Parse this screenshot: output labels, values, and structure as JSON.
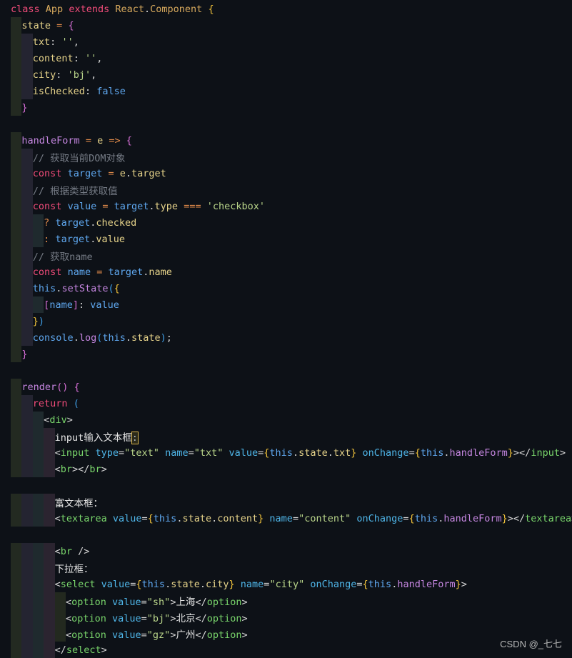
{
  "lines": [
    {
      "indent": 0,
      "tokens": [
        [
          "class",
          "k"
        ],
        [
          " ",
          "pn"
        ],
        [
          "App",
          "cls"
        ],
        [
          " ",
          "pn"
        ],
        [
          "extends",
          "k"
        ],
        [
          " ",
          "pn"
        ],
        [
          "React",
          "cls"
        ],
        [
          ".",
          "pn"
        ],
        [
          "Component",
          "cls"
        ],
        [
          " ",
          "pn"
        ],
        [
          "{",
          "g1"
        ]
      ]
    },
    {
      "indent": 1,
      "tokens": [
        [
          "state",
          "p"
        ],
        [
          " ",
          "pn"
        ],
        [
          "=",
          "op"
        ],
        [
          " ",
          "pn"
        ],
        [
          "{",
          "g2"
        ]
      ]
    },
    {
      "indent": 2,
      "tokens": [
        [
          "txt",
          "p"
        ],
        [
          ":",
          "pn"
        ],
        [
          " ",
          "pn"
        ],
        [
          "''",
          "s"
        ],
        [
          ",",
          "pn"
        ]
      ]
    },
    {
      "indent": 2,
      "tokens": [
        [
          "content",
          "p"
        ],
        [
          ":",
          "pn"
        ],
        [
          " ",
          "pn"
        ],
        [
          "''",
          "s"
        ],
        [
          ",",
          "pn"
        ]
      ]
    },
    {
      "indent": 2,
      "tokens": [
        [
          "city",
          "p"
        ],
        [
          ":",
          "pn"
        ],
        [
          " ",
          "pn"
        ],
        [
          "'bj'",
          "s"
        ],
        [
          ",",
          "pn"
        ]
      ]
    },
    {
      "indent": 2,
      "tokens": [
        [
          "isChecked",
          "p"
        ],
        [
          ":",
          "pn"
        ],
        [
          " ",
          "pn"
        ],
        [
          "false",
          "b"
        ]
      ]
    },
    {
      "indent": 1,
      "tokens": [
        [
          "}",
          "g2"
        ]
      ]
    },
    {
      "indent": 0,
      "tokens": []
    },
    {
      "indent": 1,
      "tokens": [
        [
          "handleForm",
          "f"
        ],
        [
          " ",
          "pn"
        ],
        [
          "=",
          "op"
        ],
        [
          " ",
          "pn"
        ],
        [
          "e",
          "p"
        ],
        [
          " ",
          "pn"
        ],
        [
          "=>",
          "op"
        ],
        [
          " ",
          "pn"
        ],
        [
          "{",
          "g2"
        ]
      ]
    },
    {
      "indent": 2,
      "tokens": [
        [
          "// 获取当前DOM对象",
          "c"
        ]
      ]
    },
    {
      "indent": 2,
      "tokens": [
        [
          "const",
          "k"
        ],
        [
          " ",
          "pn"
        ],
        [
          "target",
          "b"
        ],
        [
          " ",
          "pn"
        ],
        [
          "=",
          "op"
        ],
        [
          " ",
          "pn"
        ],
        [
          "e",
          "p"
        ],
        [
          ".",
          "pn"
        ],
        [
          "target",
          "p"
        ]
      ]
    },
    {
      "indent": 2,
      "tokens": [
        [
          "// 根据类型获取值",
          "c"
        ]
      ]
    },
    {
      "indent": 2,
      "tokens": [
        [
          "const",
          "k"
        ],
        [
          " ",
          "pn"
        ],
        [
          "value",
          "b"
        ],
        [
          " ",
          "pn"
        ],
        [
          "=",
          "op"
        ],
        [
          " ",
          "pn"
        ],
        [
          "target",
          "b"
        ],
        [
          ".",
          "pn"
        ],
        [
          "type",
          "p"
        ],
        [
          " ",
          "pn"
        ],
        [
          "===",
          "op"
        ],
        [
          " ",
          "pn"
        ],
        [
          "'checkbox'",
          "s"
        ]
      ]
    },
    {
      "indent": 3,
      "tokens": [
        [
          "?",
          "op"
        ],
        [
          " ",
          "pn"
        ],
        [
          "target",
          "b"
        ],
        [
          ".",
          "pn"
        ],
        [
          "checked",
          "p"
        ]
      ]
    },
    {
      "indent": 3,
      "tokens": [
        [
          ":",
          "op"
        ],
        [
          " ",
          "pn"
        ],
        [
          "target",
          "b"
        ],
        [
          ".",
          "pn"
        ],
        [
          "value",
          "p"
        ]
      ]
    },
    {
      "indent": 2,
      "tokens": [
        [
          "// 获取name",
          "c"
        ]
      ]
    },
    {
      "indent": 2,
      "tokens": [
        [
          "const",
          "k"
        ],
        [
          " ",
          "pn"
        ],
        [
          "name",
          "b"
        ],
        [
          " ",
          "pn"
        ],
        [
          "=",
          "op"
        ],
        [
          " ",
          "pn"
        ],
        [
          "target",
          "b"
        ],
        [
          ".",
          "pn"
        ],
        [
          "name",
          "p"
        ]
      ]
    },
    {
      "indent": 2,
      "tokens": [
        [
          "this",
          "b"
        ],
        [
          ".",
          "pn"
        ],
        [
          "setState",
          "f"
        ],
        [
          "(",
          "g3"
        ],
        [
          "{",
          "g1"
        ]
      ]
    },
    {
      "indent": 3,
      "tokens": [
        [
          "[",
          "g2"
        ],
        [
          "name",
          "b"
        ],
        [
          "]",
          "g2"
        ],
        [
          ":",
          "pn"
        ],
        [
          " ",
          "pn"
        ],
        [
          "value",
          "b"
        ]
      ]
    },
    {
      "indent": 2,
      "tokens": [
        [
          "}",
          "g1"
        ],
        [
          ")",
          "g3"
        ]
      ]
    },
    {
      "indent": 2,
      "tokens": [
        [
          "console",
          "b"
        ],
        [
          ".",
          "pn"
        ],
        [
          "log",
          "f"
        ],
        [
          "(",
          "g3"
        ],
        [
          "this",
          "b"
        ],
        [
          ".",
          "pn"
        ],
        [
          "state",
          "p"
        ],
        [
          ")",
          "g3"
        ],
        [
          ";",
          "pn"
        ]
      ]
    },
    {
      "indent": 1,
      "tokens": [
        [
          "}",
          "g2"
        ]
      ]
    },
    {
      "indent": 0,
      "tokens": []
    },
    {
      "indent": 1,
      "tokens": [
        [
          "render",
          "f"
        ],
        [
          "()",
          "g2"
        ],
        [
          " ",
          "pn"
        ],
        [
          "{",
          "g2"
        ]
      ]
    },
    {
      "indent": 2,
      "tokens": [
        [
          "return",
          "k"
        ],
        [
          " ",
          "pn"
        ],
        [
          "(",
          "g3"
        ]
      ]
    },
    {
      "indent": 3,
      "tokens": [
        [
          "<",
          "pn"
        ],
        [
          "div",
          "tg"
        ],
        [
          ">",
          "pn"
        ]
      ]
    },
    {
      "indent": 4,
      "tokens": [
        [
          "input输入文本框",
          "tx"
        ],
        [
          ":",
          "hl"
        ]
      ]
    },
    {
      "indent": 4,
      "tokens": [
        [
          "<",
          "pn"
        ],
        [
          "input",
          "tg"
        ],
        [
          " ",
          "pn"
        ],
        [
          "type",
          "at"
        ],
        [
          "=",
          "pn"
        ],
        [
          "\"text\"",
          "s"
        ],
        [
          " ",
          "pn"
        ],
        [
          "name",
          "at"
        ],
        [
          "=",
          "pn"
        ],
        [
          "\"txt\"",
          "s"
        ],
        [
          " ",
          "pn"
        ],
        [
          "value",
          "at"
        ],
        [
          "=",
          "pn"
        ],
        [
          "{",
          "g1"
        ],
        [
          "this",
          "b"
        ],
        [
          ".",
          "pn"
        ],
        [
          "state",
          "p"
        ],
        [
          ".",
          "pn"
        ],
        [
          "txt",
          "p"
        ],
        [
          "}",
          "g1"
        ],
        [
          " ",
          "pn"
        ],
        [
          "onChange",
          "at"
        ],
        [
          "=",
          "pn"
        ],
        [
          "{",
          "g1"
        ],
        [
          "this",
          "b"
        ],
        [
          ".",
          "pn"
        ],
        [
          "handleForm",
          "f"
        ],
        [
          "}",
          "g1"
        ],
        [
          "></",
          "pn"
        ],
        [
          "input",
          "tg"
        ],
        [
          ">",
          "pn"
        ]
      ]
    },
    {
      "indent": 4,
      "tokens": [
        [
          "<",
          "pn"
        ],
        [
          "br",
          "tg"
        ],
        [
          "></",
          "pn"
        ],
        [
          "br",
          "tg"
        ],
        [
          ">",
          "pn"
        ]
      ]
    },
    {
      "indent": 0,
      "tokens": []
    },
    {
      "indent": 4,
      "tokens": [
        [
          "富文本框：",
          "tx"
        ]
      ]
    },
    {
      "indent": 4,
      "tokens": [
        [
          "<",
          "pn"
        ],
        [
          "textarea",
          "tg"
        ],
        [
          " ",
          "pn"
        ],
        [
          "value",
          "at"
        ],
        [
          "=",
          "pn"
        ],
        [
          "{",
          "g1"
        ],
        [
          "this",
          "b"
        ],
        [
          ".",
          "pn"
        ],
        [
          "state",
          "p"
        ],
        [
          ".",
          "pn"
        ],
        [
          "content",
          "p"
        ],
        [
          "}",
          "g1"
        ],
        [
          " ",
          "pn"
        ],
        [
          "name",
          "at"
        ],
        [
          "=",
          "pn"
        ],
        [
          "\"content\"",
          "s"
        ],
        [
          " ",
          "pn"
        ],
        [
          "onChange",
          "at"
        ],
        [
          "=",
          "pn"
        ],
        [
          "{",
          "g1"
        ],
        [
          "this",
          "b"
        ],
        [
          ".",
          "pn"
        ],
        [
          "handleForm",
          "f"
        ],
        [
          "}",
          "g1"
        ],
        [
          "></",
          "pn"
        ],
        [
          "textarea",
          "tg"
        ],
        [
          ">",
          "pn"
        ]
      ]
    },
    {
      "indent": 0,
      "tokens": []
    },
    {
      "indent": 4,
      "tokens": [
        [
          "<",
          "pn"
        ],
        [
          "br",
          "tg"
        ],
        [
          " ",
          "pn"
        ],
        [
          "/>",
          "pn"
        ]
      ]
    },
    {
      "indent": 4,
      "tokens": [
        [
          "下拉框：",
          "tx"
        ]
      ]
    },
    {
      "indent": 4,
      "tokens": [
        [
          "<",
          "pn"
        ],
        [
          "select",
          "tg"
        ],
        [
          " ",
          "pn"
        ],
        [
          "value",
          "at"
        ],
        [
          "=",
          "pn"
        ],
        [
          "{",
          "g1"
        ],
        [
          "this",
          "b"
        ],
        [
          ".",
          "pn"
        ],
        [
          "state",
          "p"
        ],
        [
          ".",
          "pn"
        ],
        [
          "city",
          "p"
        ],
        [
          "}",
          "g1"
        ],
        [
          " ",
          "pn"
        ],
        [
          "name",
          "at"
        ],
        [
          "=",
          "pn"
        ],
        [
          "\"city\"",
          "s"
        ],
        [
          " ",
          "pn"
        ],
        [
          "onChange",
          "at"
        ],
        [
          "=",
          "pn"
        ],
        [
          "{",
          "g1"
        ],
        [
          "this",
          "b"
        ],
        [
          ".",
          "pn"
        ],
        [
          "handleForm",
          "f"
        ],
        [
          "}",
          "g1"
        ],
        [
          ">",
          "pn"
        ]
      ]
    },
    {
      "indent": 5,
      "tokens": [
        [
          "<",
          "pn"
        ],
        [
          "option",
          "tg"
        ],
        [
          " ",
          "pn"
        ],
        [
          "value",
          "at"
        ],
        [
          "=",
          "pn"
        ],
        [
          "\"sh\"",
          "s"
        ],
        [
          ">",
          "pn"
        ],
        [
          "上海",
          "tx"
        ],
        [
          "</",
          "pn"
        ],
        [
          "option",
          "tg"
        ],
        [
          ">",
          "pn"
        ]
      ]
    },
    {
      "indent": 5,
      "tokens": [
        [
          "<",
          "pn"
        ],
        [
          "option",
          "tg"
        ],
        [
          " ",
          "pn"
        ],
        [
          "value",
          "at"
        ],
        [
          "=",
          "pn"
        ],
        [
          "\"bj\"",
          "s"
        ],
        [
          ">",
          "pn"
        ],
        [
          "北京",
          "tx"
        ],
        [
          "</",
          "pn"
        ],
        [
          "option",
          "tg"
        ],
        [
          ">",
          "pn"
        ]
      ]
    },
    {
      "indent": 5,
      "tokens": [
        [
          "<",
          "pn"
        ],
        [
          "option",
          "tg"
        ],
        [
          " ",
          "pn"
        ],
        [
          "value",
          "at"
        ],
        [
          "=",
          "pn"
        ],
        [
          "\"gz\"",
          "s"
        ],
        [
          ">",
          "pn"
        ],
        [
          "广州",
          "tx"
        ],
        [
          "</",
          "pn"
        ],
        [
          "option",
          "tg"
        ],
        [
          ">",
          "pn"
        ]
      ]
    },
    {
      "indent": 4,
      "tokens": [
        [
          "</",
          "pn"
        ],
        [
          "select",
          "tg"
        ],
        [
          ">",
          "pn"
        ]
      ]
    }
  ],
  "indent_guide_colors": [
    "#232a21",
    "#242431",
    "#1f2a2e",
    "#2b2430",
    "#23291f"
  ],
  "watermark": "CSDN @_七七"
}
